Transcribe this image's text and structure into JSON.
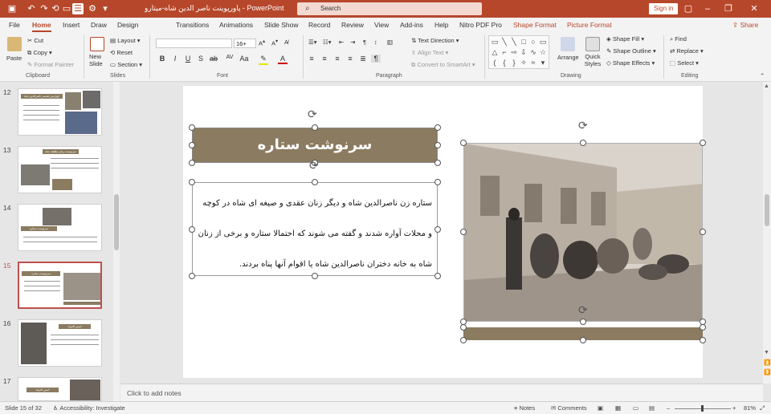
{
  "titlebar": {
    "doc_title": "پاورپوینت ناصر الدین شاه-میتارو  -  PowerPoint",
    "search_placeholder": "Search",
    "sign_in": "Sign in"
  },
  "tabs": [
    "File",
    "Home",
    "Insert",
    "Draw",
    "Design",
    "Transitions",
    "Animations",
    "Slide Show",
    "Record",
    "Review",
    "View",
    "Add-ins",
    "Help",
    "Nitro PDF Pro",
    "Shape Format",
    "Picture Format"
  ],
  "share_label": "Share",
  "ribbon": {
    "clipboard": {
      "paste": "Paste",
      "cut": "Cut",
      "copy": "Copy",
      "format_painter": "Format Painter",
      "label": "Clipboard"
    },
    "slides": {
      "new_slide": "New Slide",
      "layout": "Layout",
      "reset": "Reset",
      "section": "Section",
      "label": "Slides"
    },
    "font": {
      "size": "16+",
      "label": "Font"
    },
    "paragraph": {
      "text_direction": "Text Direction",
      "align_text": "Align Text",
      "smartart": "Convert to SmartArt",
      "label": "Paragraph"
    },
    "drawing": {
      "arrange": "Arrange",
      "quick_styles": "Quick Styles",
      "shape_fill": "Shape Fill",
      "shape_outline": "Shape Outline",
      "shape_effects": "Shape Effects",
      "label": "Drawing"
    },
    "editing": {
      "find": "Find",
      "replace": "Replace",
      "select": "Select",
      "label": "Editing"
    }
  },
  "thumbnails": [
    {
      "num": "12",
      "title": "چهارمین همسر ناصرالدین شاه"
    },
    {
      "num": "13",
      "title": "سرنوشت زنان مطلقه شاه"
    },
    {
      "num": "14",
      "title": "سرنوشت ستاره"
    },
    {
      "num": "15",
      "title": "سرنوشت ستاره"
    },
    {
      "num": "16",
      "title": "انیس الدوله"
    },
    {
      "num": "17",
      "title": "انیس الدوله"
    }
  ],
  "slide": {
    "title": "سرنوشت ستاره",
    "body_lines": [
      "ستاره زن ناصرالدین شاه و دیگر زنان عقدی و صیغه ای شاه در کوچه",
      "و محلات آواره شدند و گفته می شوند که احتمالا ستاره و برخی از زنان",
      "شاه به خانه دختران ناصرالدین شاه یا اقوام آنها پناه بردند."
    ]
  },
  "notes_placeholder": "Click to add notes",
  "status": {
    "slide_of": "Slide 15 of 32",
    "accessibility": "Accessibility: Investigate",
    "notes": "Notes",
    "comments": "Comments",
    "zoom": "81%"
  },
  "colors": {
    "accent": "#b7472a",
    "slide_band": "#8b7b60"
  }
}
